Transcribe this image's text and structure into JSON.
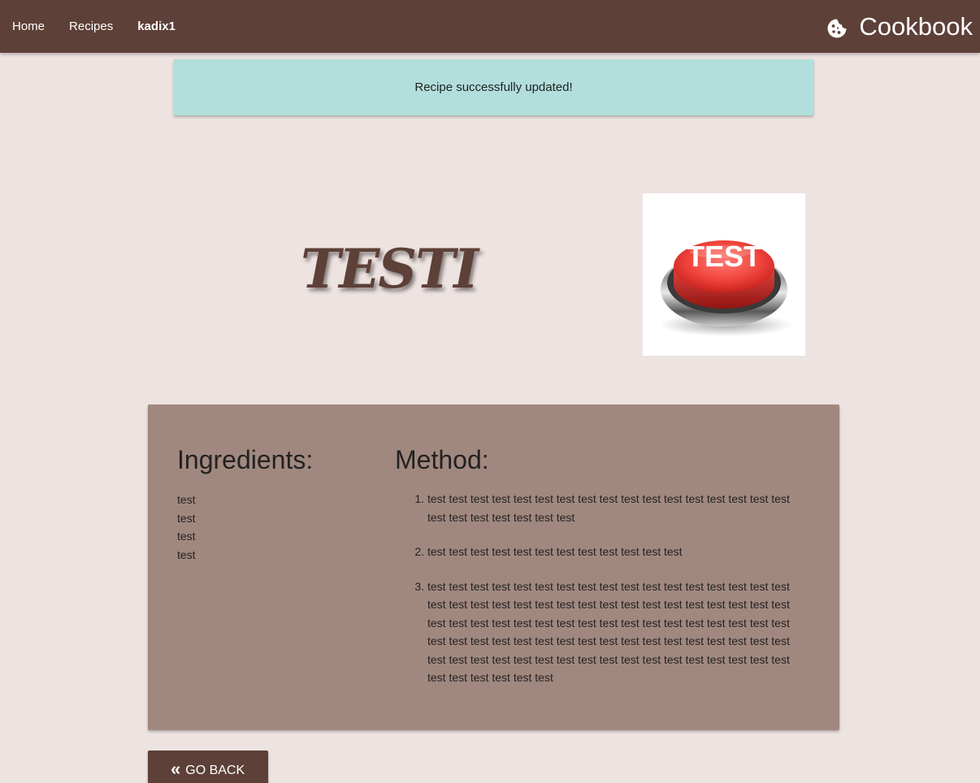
{
  "navbar": {
    "links": [
      "Home",
      "Recipes"
    ],
    "user": "kadix1",
    "brand": {
      "icon": "cookie-icon",
      "title": "Cookbook"
    },
    "background_color": "#5d4037"
  },
  "alert": {
    "message": "Recipe successfully updated!",
    "background_color": "#b2dfdb"
  },
  "recipe": {
    "title": "TESTI",
    "image": {
      "label": "TEST",
      "icon": "red-test-button-image"
    },
    "ingredients_heading": "Ingredients:",
    "ingredients": [
      "test",
      "test",
      "test",
      "test"
    ],
    "method_heading": "Method:",
    "method_steps": [
      "test test test test test test test test test test test test test test test test test test test test test test test test",
      "test test test test test test test test test test test test",
      "test test test test test test test test test test test test test test test test test test test test test test test test test test test test test test test test test test test test test test test test test test test test test test test test test test test test test test test test test test test test test test test test test test test test test test test test test test test test test test test test test test test test test test test test test test test"
    ],
    "card_color": "#a1887f"
  },
  "back_button": {
    "icon": "double-chevron-left-icon",
    "label": "Go back"
  }
}
